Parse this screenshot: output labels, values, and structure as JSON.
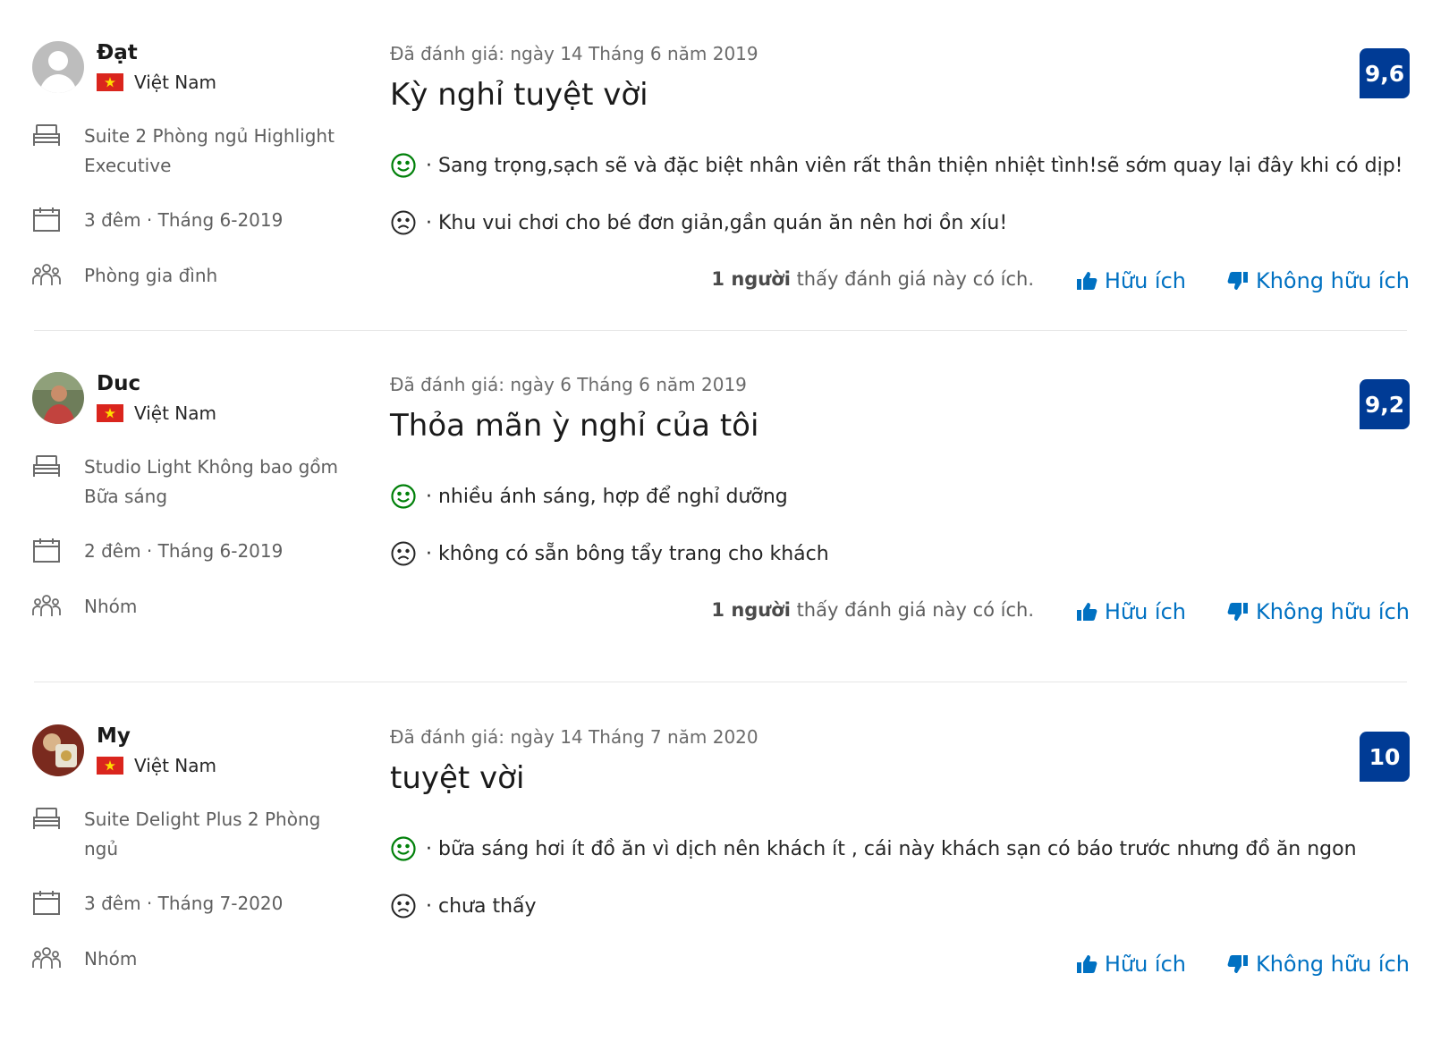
{
  "colors": {
    "brand_blue": "#003b95",
    "link_blue": "#0071c2",
    "positive_green": "#008009",
    "negative_gray": "#262626"
  },
  "reviews": [
    {
      "name": "Đạt",
      "country": "Việt Nam",
      "room": "Suite 2 Phòng ngủ Highlight Executive",
      "stay": "3 đêm · Tháng 6-2019",
      "traveler_type": "Phòng gia đình",
      "date": "Đã đánh giá: ngày 14 Tháng 6 năm 2019",
      "title": "Kỳ nghỉ tuyệt vời",
      "score": "9,6",
      "positive": "· Sang trọng,sạch sẽ và đặc biệt nhân viên rất thân thiện nhiệt tình!sẽ sớm quay lại đây khi có dịp!",
      "negative": "· Khu vui chơi cho bé đơn giản,gần quán ăn nên hơi ồn xíu!",
      "helpful_count": "1 người",
      "helpful_text": " thấy đánh giá này có ích.",
      "helpful_label": "Hữu ích",
      "not_helpful_label": "Không hữu ích"
    },
    {
      "name": "Duc",
      "country": "Việt Nam",
      "room": "Studio Light Không bao gồm Bữa sáng",
      "stay": "2 đêm · Tháng 6-2019",
      "traveler_type": "Nhóm",
      "date": "Đã đánh giá: ngày 6 Tháng 6 năm 2019",
      "title": "Thỏa mãn ỳ nghỉ của tôi",
      "score": "9,2",
      "positive": "· nhiều ánh sáng, hợp để nghỉ dưỡng",
      "negative": "· không có sẵn bông tẩy trang cho khách",
      "helpful_count": "1 người",
      "helpful_text": " thấy đánh giá này có ích.",
      "helpful_label": "Hữu ích",
      "not_helpful_label": "Không hữu ích"
    },
    {
      "name": "My",
      "country": "Việt Nam",
      "room": "Suite Delight Plus 2 Phòng ngủ",
      "stay": "3 đêm · Tháng 7-2020",
      "traveler_type": "Nhóm",
      "date": "Đã đánh giá: ngày 14 Tháng 7 năm 2020",
      "title": "tuyệt vời",
      "score": "10",
      "positive": "· bữa sáng hơi ít đồ ăn vì dịch nên khách ít , cái này khách sạn có báo trước nhưng đồ ăn ngon",
      "negative": "· chưa thấy",
      "helpful_label": "Hữu ích",
      "not_helpful_label": "Không hữu ích"
    }
  ]
}
